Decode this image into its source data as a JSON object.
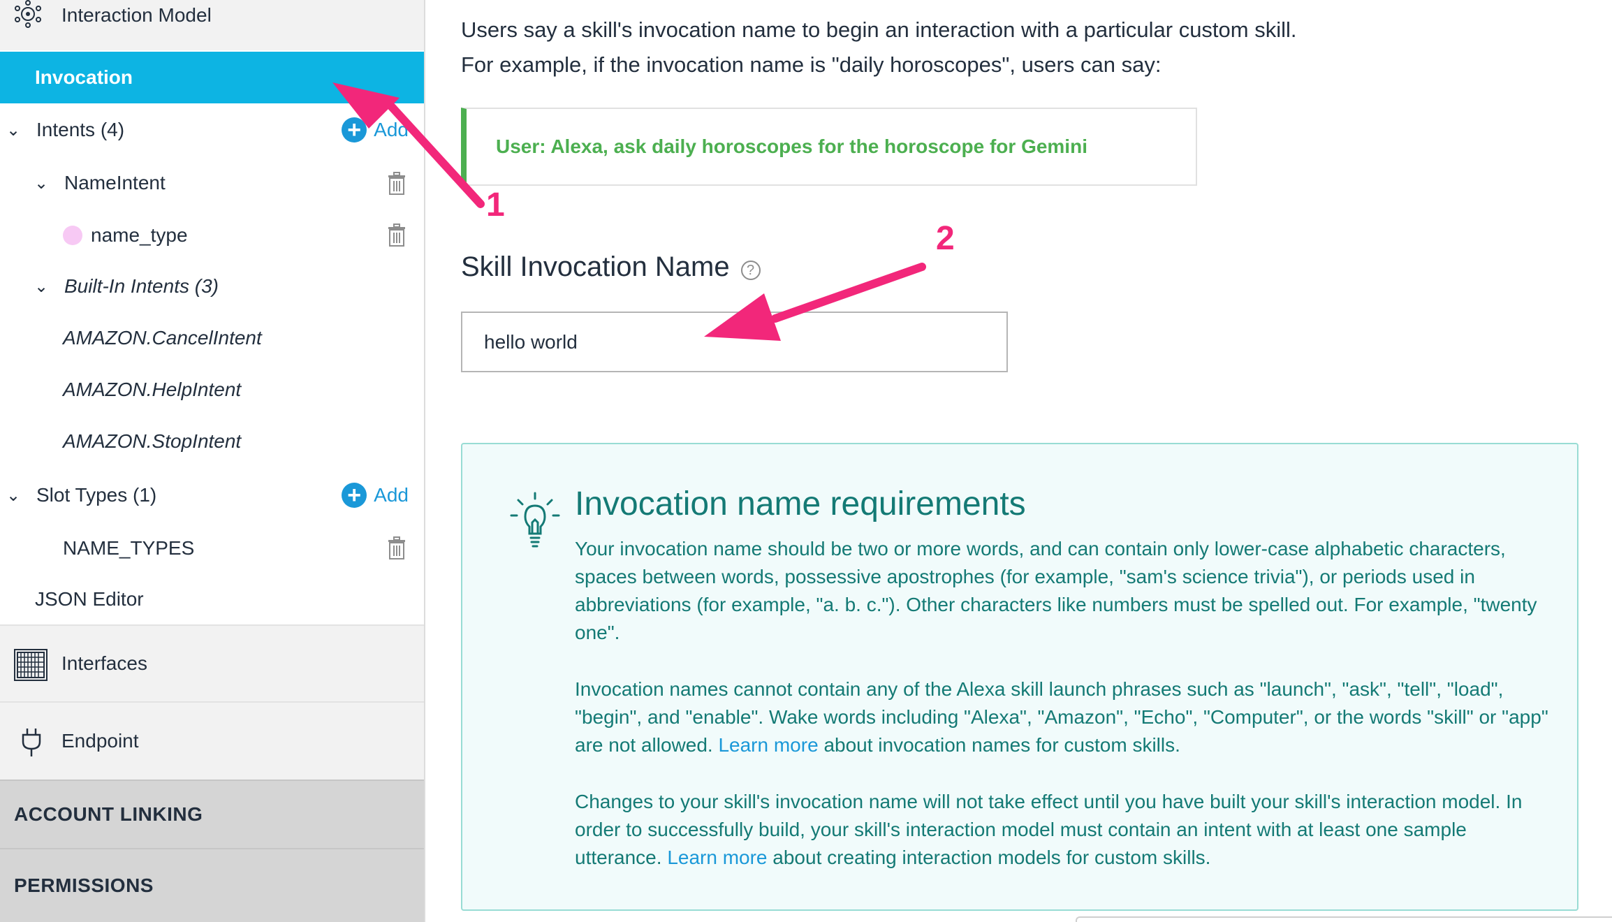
{
  "sidebar": {
    "interaction_model": "Interaction Model",
    "invocation": "Invocation",
    "intents": "Intents (4)",
    "intents_add": "Add",
    "name_intent": "NameIntent",
    "name_type_slot": "name_type",
    "built_in_intents": "Built-In Intents (3)",
    "cancel_intent": "AMAZON.CancelIntent",
    "help_intent": "AMAZON.HelpIntent",
    "stop_intent": "AMAZON.StopIntent",
    "slot_types": "Slot Types (1)",
    "slot_types_add": "Add",
    "name_types": "NAME_TYPES",
    "json_editor": "JSON Editor",
    "interfaces": "Interfaces",
    "endpoint": "Endpoint",
    "account_linking": "ACCOUNT LINKING",
    "permissions": "PERMISSIONS"
  },
  "main": {
    "intro_line1": "Users say a skill's invocation name to begin an interaction with a particular custom skill.",
    "intro_line2": "For example, if the invocation name is \"daily horoscopes\", users can say:",
    "example_utterance": "User: Alexa, ask daily horoscopes for the horoscope for Gemini",
    "field_label": "Skill Invocation Name",
    "help_glyph": "?",
    "invocation_name_value": "hello world",
    "requirements": {
      "title": "Invocation name requirements",
      "para1": "Your invocation name should be two or more words, and can contain only lower-case alphabetic characters, spaces between words, possessive apostrophes (for example, \"sam's science trivia\"), or periods used in abbreviations (for example, \"a. b. c.\"). Other characters like numbers must be spelled out. For example, \"twenty one\".",
      "para2_before": "Invocation names cannot contain any of the Alexa skill launch phrases such as \"launch\", \"ask\", \"tell\", \"load\", \"begin\", and \"enable\". Wake words including \"Alexa\", \"Amazon\", \"Echo\", \"Computer\", or the words \"skill\" or \"app\" are not allowed.",
      "para2_link": "Learn more",
      "para2_after": "about invocation names for custom skills.",
      "para3_before": "Changes to your skill's invocation name will not take effect until you have built your skill's interaction model. In order to successfully build, your skill's interaction model must contain an intent with at least one sample utterance.",
      "para3_link": "Learn more",
      "para3_after": "about creating interaction models for custom skills."
    }
  },
  "annotations": {
    "label_1": "1",
    "label_2": "2",
    "arrow_color": "#f2277a"
  },
  "colors": {
    "active_item": "#0db4e3",
    "example_green": "#4caf50",
    "requirements_text": "#147a75",
    "link_blue": "#1a98d8"
  }
}
